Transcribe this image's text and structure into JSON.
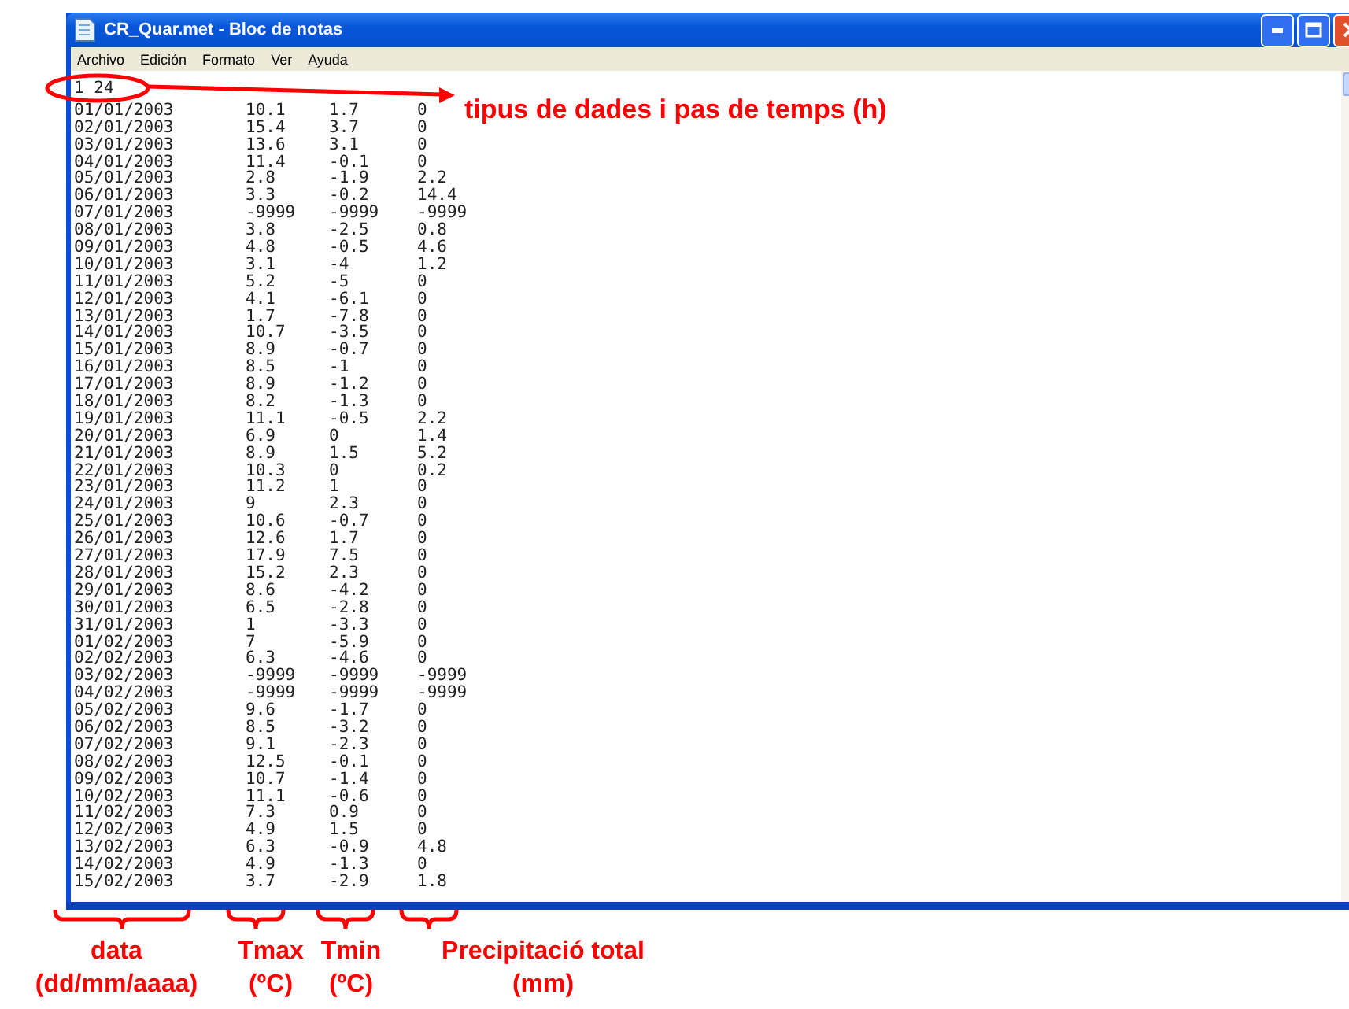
{
  "window": {
    "title": "CR_Quar.met - Bloc de notas"
  },
  "menu": [
    "Archivo",
    "Edición",
    "Formato",
    "Ver",
    "Ayuda"
  ],
  "file": {
    "header": "1 24",
    "rows": [
      {
        "date": "01/01/2003",
        "tmax": "10.1",
        "tmin": "1.7",
        "precipitation": "0"
      },
      {
        "date": "02/01/2003",
        "tmax": "15.4",
        "tmin": "3.7",
        "precipitation": "0"
      },
      {
        "date": "03/01/2003",
        "tmax": "13.6",
        "tmin": "3.1",
        "precipitation": "0"
      },
      {
        "date": "04/01/2003",
        "tmax": "11.4",
        "tmin": "-0.1",
        "precipitation": "0"
      },
      {
        "date": "05/01/2003",
        "tmax": "2.8",
        "tmin": "-1.9",
        "precipitation": "2.2"
      },
      {
        "date": "06/01/2003",
        "tmax": "3.3",
        "tmin": "-0.2",
        "precipitation": "14.4"
      },
      {
        "date": "07/01/2003",
        "tmax": "-9999",
        "tmin": "-9999",
        "precipitation": "-9999"
      },
      {
        "date": "08/01/2003",
        "tmax": "3.8",
        "tmin": "-2.5",
        "precipitation": "0.8"
      },
      {
        "date": "09/01/2003",
        "tmax": "4.8",
        "tmin": "-0.5",
        "precipitation": "4.6"
      },
      {
        "date": "10/01/2003",
        "tmax": "3.1",
        "tmin": "-4",
        "precipitation": "1.2"
      },
      {
        "date": "11/01/2003",
        "tmax": "5.2",
        "tmin": "-5",
        "precipitation": "0"
      },
      {
        "date": "12/01/2003",
        "tmax": "4.1",
        "tmin": "-6.1",
        "precipitation": "0"
      },
      {
        "date": "13/01/2003",
        "tmax": "1.7",
        "tmin": "-7.8",
        "precipitation": "0"
      },
      {
        "date": "14/01/2003",
        "tmax": "10.7",
        "tmin": "-3.5",
        "precipitation": "0"
      },
      {
        "date": "15/01/2003",
        "tmax": "8.9",
        "tmin": "-0.7",
        "precipitation": "0"
      },
      {
        "date": "16/01/2003",
        "tmax": "8.5",
        "tmin": "-1",
        "precipitation": "0"
      },
      {
        "date": "17/01/2003",
        "tmax": "8.9",
        "tmin": "-1.2",
        "precipitation": "0"
      },
      {
        "date": "18/01/2003",
        "tmax": "8.2",
        "tmin": "-1.3",
        "precipitation": "0"
      },
      {
        "date": "19/01/2003",
        "tmax": "11.1",
        "tmin": "-0.5",
        "precipitation": "2.2"
      },
      {
        "date": "20/01/2003",
        "tmax": "6.9",
        "tmin": "0",
        "precipitation": "1.4"
      },
      {
        "date": "21/01/2003",
        "tmax": "8.9",
        "tmin": "1.5",
        "precipitation": "5.2"
      },
      {
        "date": "22/01/2003",
        "tmax": "10.3",
        "tmin": "0",
        "precipitation": "0.2"
      },
      {
        "date": "23/01/2003",
        "tmax": "11.2",
        "tmin": "1",
        "precipitation": "0"
      },
      {
        "date": "24/01/2003",
        "tmax": "9",
        "tmin": "2.3",
        "precipitation": "0"
      },
      {
        "date": "25/01/2003",
        "tmax": "10.6",
        "tmin": "-0.7",
        "precipitation": "0"
      },
      {
        "date": "26/01/2003",
        "tmax": "12.6",
        "tmin": "1.7",
        "precipitation": "0"
      },
      {
        "date": "27/01/2003",
        "tmax": "17.9",
        "tmin": "7.5",
        "precipitation": "0"
      },
      {
        "date": "28/01/2003",
        "tmax": "15.2",
        "tmin": "2.3",
        "precipitation": "0"
      },
      {
        "date": "29/01/2003",
        "tmax": "8.6",
        "tmin": "-4.2",
        "precipitation": "0"
      },
      {
        "date": "30/01/2003",
        "tmax": "6.5",
        "tmin": "-2.8",
        "precipitation": "0"
      },
      {
        "date": "31/01/2003",
        "tmax": "1",
        "tmin": "-3.3",
        "precipitation": "0"
      },
      {
        "date": "01/02/2003",
        "tmax": "7",
        "tmin": "-5.9",
        "precipitation": "0"
      },
      {
        "date": "02/02/2003",
        "tmax": "6.3",
        "tmin": "-4.6",
        "precipitation": "0"
      },
      {
        "date": "03/02/2003",
        "tmax": "-9999",
        "tmin": "-9999",
        "precipitation": "-9999"
      },
      {
        "date": "04/02/2003",
        "tmax": "-9999",
        "tmin": "-9999",
        "precipitation": "-9999"
      },
      {
        "date": "05/02/2003",
        "tmax": "9.6",
        "tmin": "-1.7",
        "precipitation": "0"
      },
      {
        "date": "06/02/2003",
        "tmax": "8.5",
        "tmin": "-3.2",
        "precipitation": "0"
      },
      {
        "date": "07/02/2003",
        "tmax": "9.1",
        "tmin": "-2.3",
        "precipitation": "0"
      },
      {
        "date": "08/02/2003",
        "tmax": "12.5",
        "tmin": "-0.1",
        "precipitation": "0"
      },
      {
        "date": "09/02/2003",
        "tmax": "10.7",
        "tmin": "-1.4",
        "precipitation": "0"
      },
      {
        "date": "10/02/2003",
        "tmax": "11.1",
        "tmin": "-0.6",
        "precipitation": "0"
      },
      {
        "date": "11/02/2003",
        "tmax": "7.3",
        "tmin": "0.9",
        "precipitation": "0"
      },
      {
        "date": "12/02/2003",
        "tmax": "4.9",
        "tmin": "1.5",
        "precipitation": "0"
      },
      {
        "date": "13/02/2003",
        "tmax": "6.3",
        "tmin": "-0.9",
        "precipitation": "4.8"
      },
      {
        "date": "14/02/2003",
        "tmax": "4.9",
        "tmin": "-1.3",
        "precipitation": "0"
      },
      {
        "date": "15/02/2003",
        "tmax": "3.7",
        "tmin": "-2.9",
        "precipitation": "1.8"
      }
    ]
  },
  "annotations": {
    "header_callout": "tipus de dades i pas de temps (h)",
    "column_labels": [
      {
        "title": "data",
        "unit": "(dd/mm/aaaa)"
      },
      {
        "title": "Tmax",
        "unit": "(ºC)"
      },
      {
        "title": "Tmin",
        "unit": "(ºC)"
      },
      {
        "title": "Precipitació total",
        "unit": "(mm)"
      }
    ]
  }
}
